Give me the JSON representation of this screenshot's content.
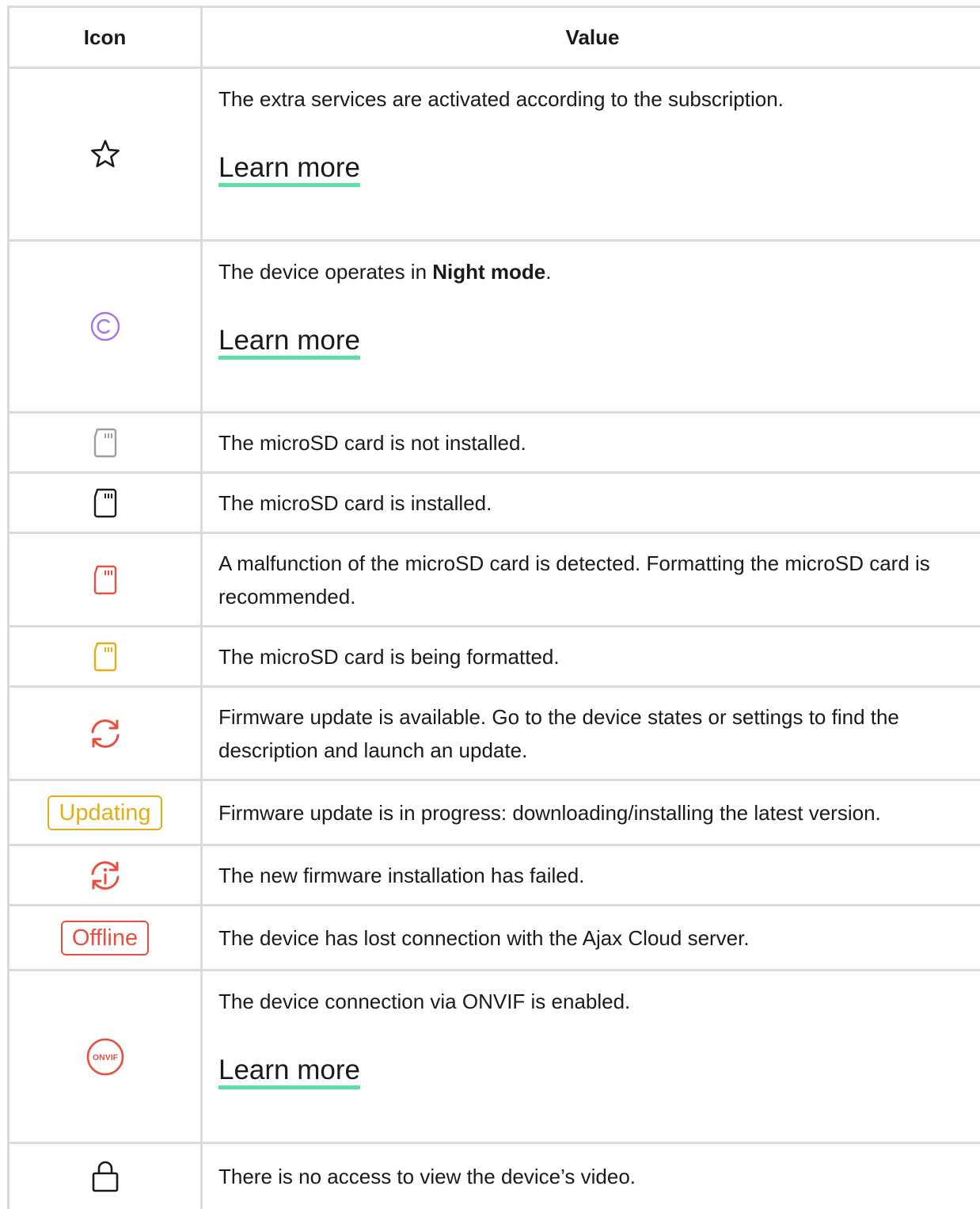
{
  "table": {
    "headers": {
      "icon": "Icon",
      "value": "Value"
    },
    "rows": [
      {
        "icon_name": "star-icon",
        "text": "The extra services are activated according to the subscription.",
        "link": "Learn more"
      },
      {
        "icon_name": "night-mode-icon",
        "text_before": "The device operates in ",
        "text_bold": "Night mode",
        "text_after": ".",
        "link": "Learn more"
      },
      {
        "icon_name": "sd-card-not-installed-icon",
        "text": "The microSD card is not installed."
      },
      {
        "icon_name": "sd-card-installed-icon",
        "text": "The microSD card is installed."
      },
      {
        "icon_name": "sd-card-malfunction-icon",
        "text": "A malfunction of the microSD card is detected. Formatting the microSD card is recommended."
      },
      {
        "icon_name": "sd-card-formatting-icon",
        "text": "The microSD card is being formatted."
      },
      {
        "icon_name": "firmware-update-icon",
        "text": "Firmware update is available. Go to the device states or settings to find the description and launch an update."
      },
      {
        "badge": "Updating",
        "text": "Firmware update is in progress: downloading/installing the latest version."
      },
      {
        "icon_name": "update-failed-icon",
        "text": "The new firmware installation has failed."
      },
      {
        "badge": "Offline",
        "text": "The device has lost connection with the Ajax Cloud server."
      },
      {
        "icon_name": "onvif-icon",
        "icon_text": "ONVIF",
        "text": "The device connection via ONVIF is enabled.",
        "link": "Learn more"
      },
      {
        "icon_name": "lock-icon",
        "text": "There is no access to view the device’s video."
      }
    ]
  },
  "colors": {
    "grid_line": "#dadada",
    "link_underline": "#5ee0a4",
    "night_mode": "#a873ea",
    "sd_not_installed": "#9e9e9e",
    "sd_installed": "#1a1a1a",
    "error_red": "#e7503f",
    "warning_yellow": "#e5ad15"
  }
}
